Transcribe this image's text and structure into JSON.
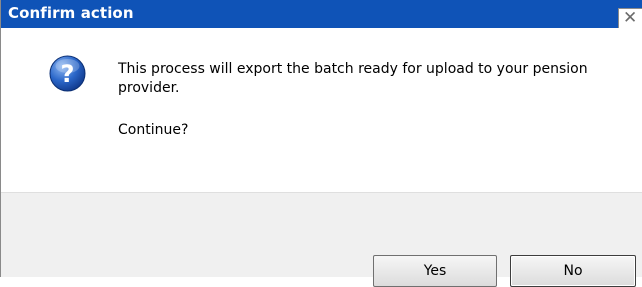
{
  "dialog": {
    "title": "Confirm action",
    "close_icon": "close-icon",
    "message_icon": "question-icon",
    "message": "This process will export the batch ready for upload to your pension provider.",
    "prompt": "Continue?",
    "buttons": {
      "yes_label": "Yes",
      "no_label": "No"
    }
  },
  "colors": {
    "titlebar": "#0f53b7",
    "dialog_background": "#f0f0f0",
    "content_background": "#ffffff"
  }
}
